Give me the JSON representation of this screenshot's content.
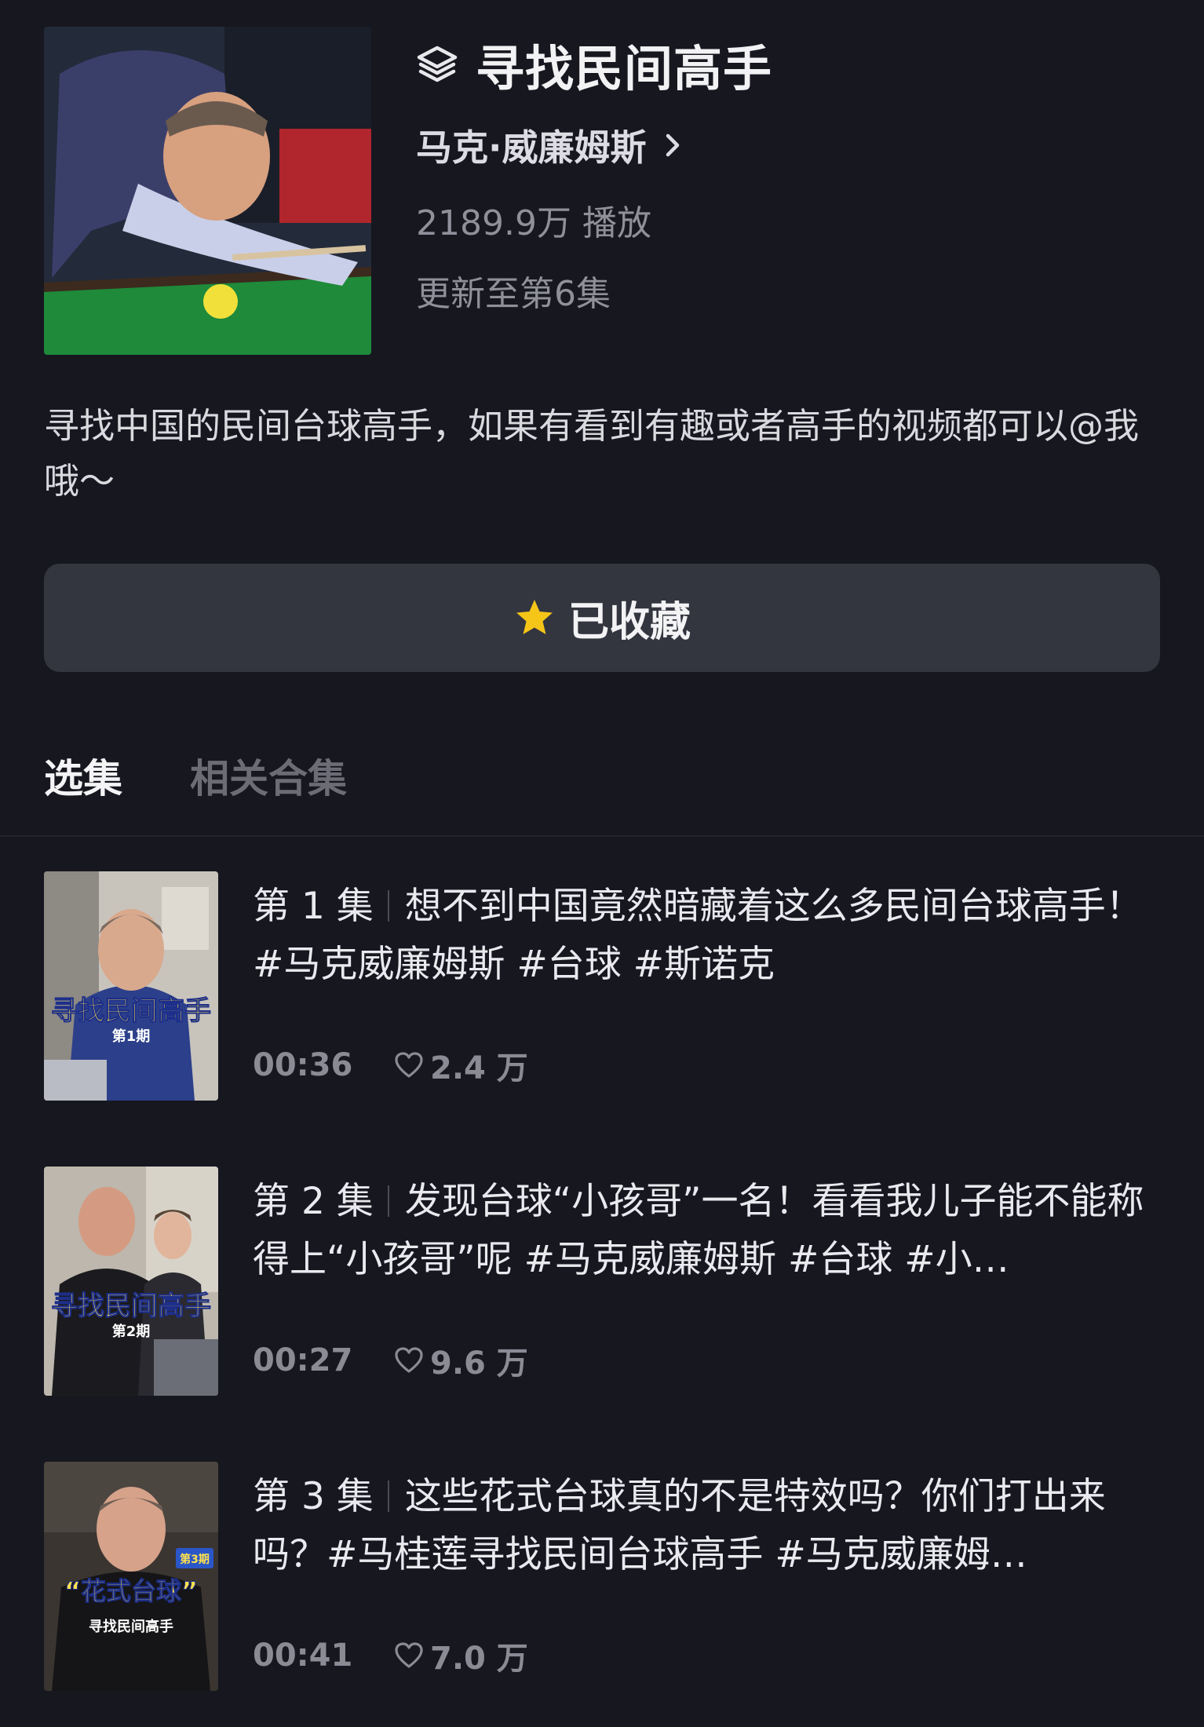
{
  "header": {
    "title": "寻找民间高手",
    "author": "马克·威廉姆斯",
    "plays": "2189.9万 播放",
    "updates": "更新至第6集"
  },
  "description": "寻找中国的民间台球高手，如果有看到有趣或者高手的视频都可以@我哦～",
  "collect_button": {
    "label": "已收藏",
    "icon": "star-icon"
  },
  "tabs": [
    {
      "label": "选集",
      "active": true
    },
    {
      "label": "相关合集",
      "active": false
    }
  ],
  "episodes": [
    {
      "number": "第 1 集",
      "title": "想不到中国竟然暗藏着这么多民间台球高手！#马克威廉姆斯 #台球 #斯诺克",
      "duration": "00:36",
      "likes": "2.4 万",
      "thumb_caption": "寻找民间高手",
      "thumb_sub": "第1期"
    },
    {
      "number": "第 2 集",
      "title": "发现台球“小孩哥”一名！看看我儿子能不能称得上“小孩哥”呢 #马克威廉姆斯 #台球 #小…",
      "duration": "00:27",
      "likes": "9.6 万",
      "thumb_caption": "寻找民间高手",
      "thumb_sub": "第2期"
    },
    {
      "number": "第 3 集",
      "title": "这些花式台球真的不是特效吗？你们打出来吗？#马桂莲寻找民间台球高手 #马克威廉姆…",
      "duration": "00:41",
      "likes": "7.0 万",
      "thumb_caption": "“花式台球”",
      "thumb_sub": "寻找民间高手",
      "thumb_badge": "第3期"
    }
  ],
  "colors": {
    "background": "#16171f",
    "button": "#33353f",
    "star": "#f5c518",
    "muted_text": "#8f909a"
  }
}
